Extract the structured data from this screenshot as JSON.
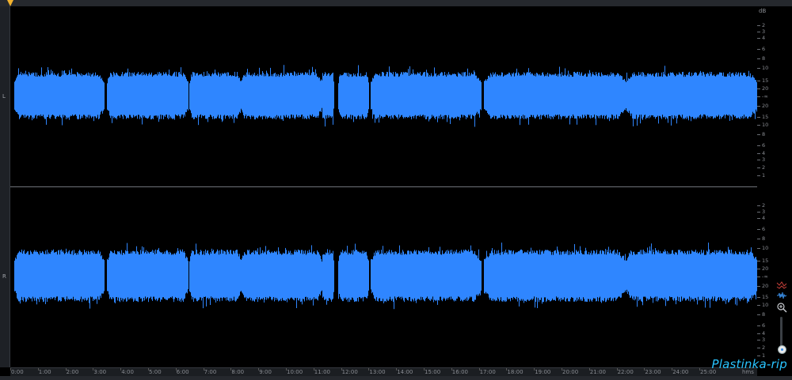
{
  "channels": {
    "left_label": "L",
    "right_label": "R"
  },
  "db_ruler": {
    "unit": "dB",
    "labels": [
      "2",
      "3",
      "4",
      "6",
      "8",
      "10",
      "15",
      "20",
      "-∞",
      "20",
      "15",
      "10",
      "8",
      "6",
      "4",
      "3",
      "2",
      "1"
    ],
    "unit_right_top": "dB"
  },
  "time_ruler": {
    "labels": [
      "0:00",
      "1:00",
      "2:00",
      "3:00",
      "4:00",
      "5:00",
      "6:00",
      "7:00",
      "8:00",
      "9:00",
      "10:00",
      "11:00",
      "12:00",
      "13:00",
      "14:00",
      "15:00",
      "16:00",
      "17:00",
      "18:00",
      "19:00",
      "20:00",
      "21:00",
      "22:00",
      "23:00",
      "24:00",
      "25:00"
    ],
    "end_label": "hms"
  },
  "right_panel": {
    "icons": [
      "spectrum-icon",
      "waveform-icon",
      "zoom-in-icon",
      "zoom-slider"
    ]
  },
  "watermark": "Plastinka-rip",
  "colors": {
    "waveform": "#2f86ff",
    "background": "#000000",
    "playhead": "#f2b22e",
    "watermark": "#29c4ff"
  }
}
